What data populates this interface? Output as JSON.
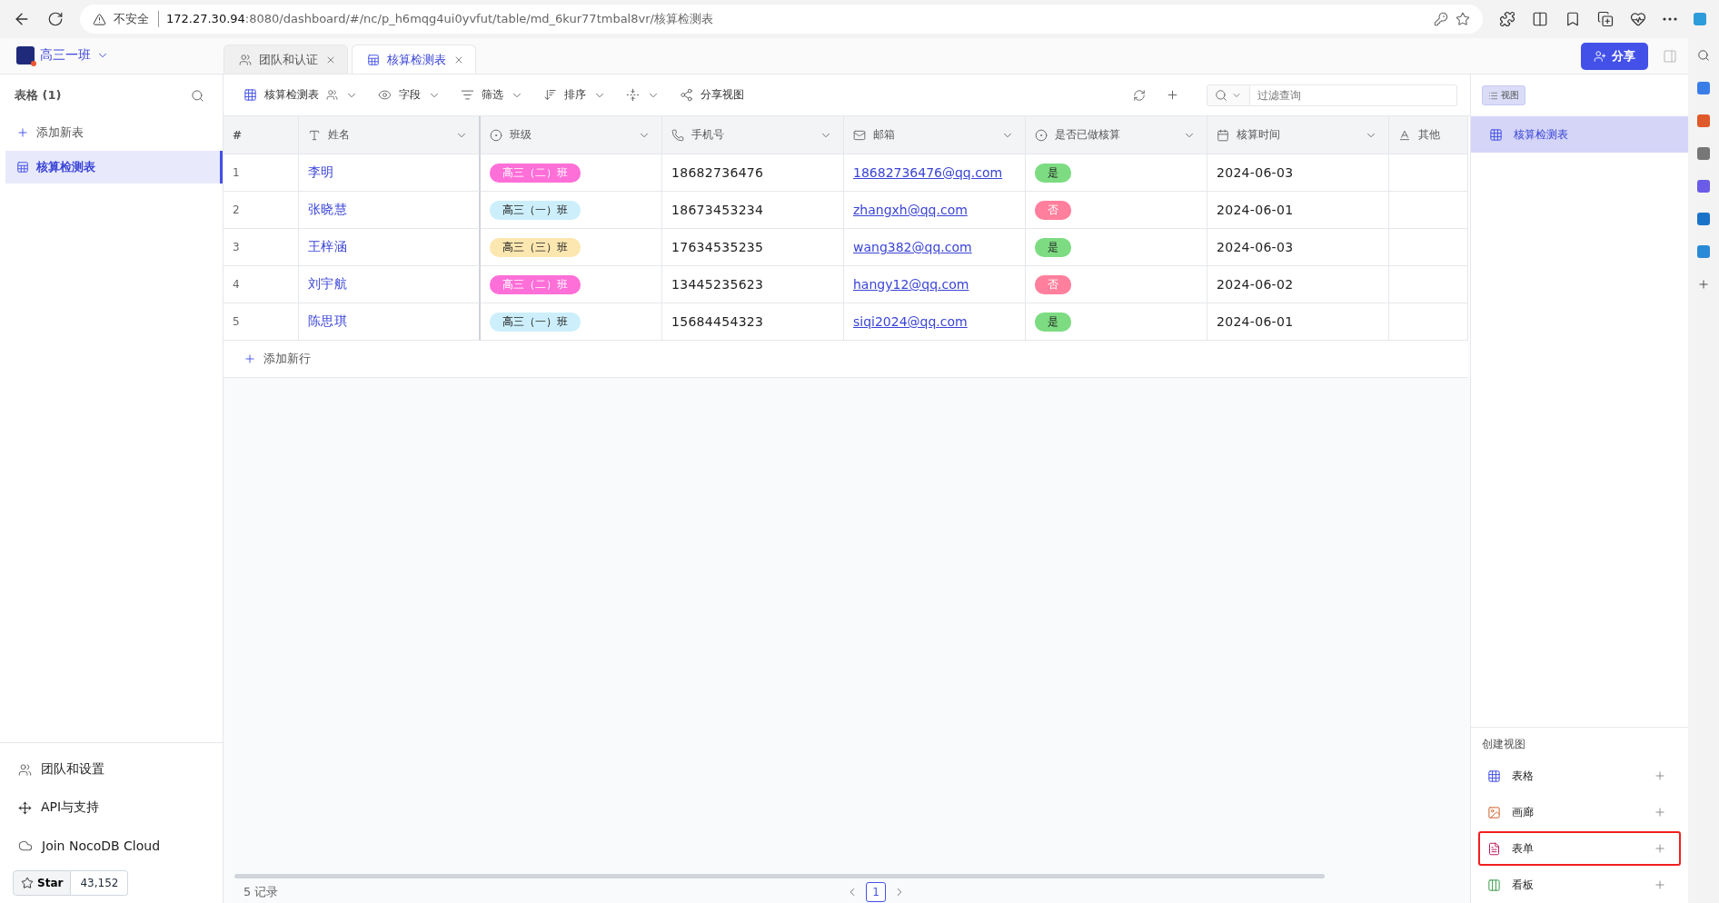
{
  "browser": {
    "security": "不安全",
    "url_host": "172.27.30.94",
    "url_rest": ":8080/dashboard/#/nc/p_h6mqg4ui0yvfut/table/md_6kur77tmbal8vr/核算检测表"
  },
  "workspace": {
    "name": "高三一班"
  },
  "tabs": [
    {
      "label": "团队和认证",
      "selected": false,
      "kind": "team"
    },
    {
      "label": "核算检测表",
      "selected": true,
      "kind": "table"
    }
  ],
  "share_button": "分享",
  "sidebar": {
    "heading": "表格 (1)",
    "add_table": "添加新表",
    "items": [
      {
        "label": "核算检测表",
        "selected": true
      }
    ],
    "footer": [
      {
        "label": "团队和设置",
        "kind": "team"
      },
      {
        "label": "API与支持",
        "kind": "api"
      },
      {
        "label": "Join NocoDB Cloud",
        "kind": "cloud"
      }
    ],
    "star": {
      "label": "Star",
      "count": "43,152"
    }
  },
  "toolbar": {
    "view_name": "核算检测表",
    "fields": "字段",
    "filter": "筛选",
    "sort": "排序",
    "share_view": "分享视图",
    "search_placeholder": "过滤查询"
  },
  "table": {
    "columns": [
      {
        "label": "#",
        "kind": "index"
      },
      {
        "label": "姓名",
        "kind": "text"
      },
      {
        "label": "班级",
        "kind": "select"
      },
      {
        "label": "手机号",
        "kind": "phone"
      },
      {
        "label": "邮箱",
        "kind": "email"
      },
      {
        "label": "是否已做核算",
        "kind": "select"
      },
      {
        "label": "核算时间",
        "kind": "date"
      },
      {
        "label": "其他",
        "kind": "longtext"
      }
    ],
    "rows": [
      {
        "index": "1",
        "name": "李明",
        "class": {
          "label": "高三（二）班",
          "color": "#ff6fd8"
        },
        "phone": "18682736476",
        "email": "18682736476@qq.com",
        "done": {
          "label": "是",
          "color": "#7ddc82"
        },
        "date": "2024-06-03"
      },
      {
        "index": "2",
        "name": "张晓慧",
        "class": {
          "label": "高三（一）班",
          "color": "#cdeffc"
        },
        "phone": "18673453234",
        "email": "zhangxh@qq.com",
        "done": {
          "label": "否",
          "color": "#ff7f9c"
        },
        "date": "2024-06-01"
      },
      {
        "index": "3",
        "name": "王梓涵",
        "class": {
          "label": "高三（三）班",
          "color": "#fde7b0"
        },
        "phone": "17634535235",
        "email": "wang382@qq.com",
        "done": {
          "label": "是",
          "color": "#7ddc82"
        },
        "date": "2024-06-03"
      },
      {
        "index": "4",
        "name": "刘宇航",
        "class": {
          "label": "高三（二）班",
          "color": "#ff6fd8"
        },
        "phone": "13445235623",
        "email": "hangy12@qq.com",
        "done": {
          "label": "否",
          "color": "#ff7f9c"
        },
        "date": "2024-06-02"
      },
      {
        "index": "5",
        "name": "陈思琪",
        "class": {
          "label": "高三（一）班",
          "color": "#cdeffc"
        },
        "phone": "15684454323",
        "email": "siqi2024@qq.com",
        "done": {
          "label": "是",
          "color": "#7ddc82"
        },
        "date": "2024-06-01"
      }
    ],
    "add_row": "添加新行",
    "record_count": "5 记录",
    "page": "1"
  },
  "views_panel": {
    "toggle": "视图",
    "views": [
      {
        "label": "核算检测表",
        "selected": true
      }
    ],
    "create_heading": "创建视图",
    "create_items": [
      {
        "label": "表格",
        "kind": "grid",
        "highlighted": false
      },
      {
        "label": "画廊",
        "kind": "gallery",
        "highlighted": false
      },
      {
        "label": "表单",
        "kind": "form",
        "highlighted": true
      },
      {
        "label": "看板",
        "kind": "kanban",
        "highlighted": false
      }
    ]
  }
}
